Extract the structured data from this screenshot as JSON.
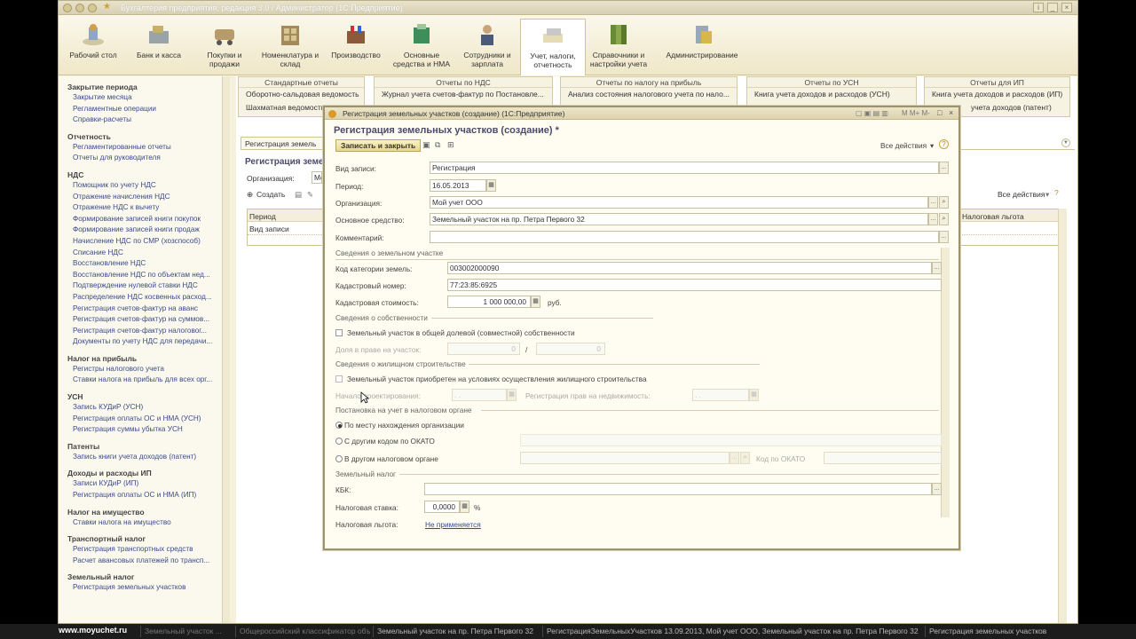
{
  "window": {
    "title": "Бухгалтерия предприятия, редакция 3.0 / Администратор  (1С:Предприятие)"
  },
  "toolbar": {
    "items": [
      {
        "label": "Рабочий стол"
      },
      {
        "label": "Банк и касса"
      },
      {
        "label": "Покупки и продажи"
      },
      {
        "label": "Номенклатура и склад"
      },
      {
        "label": "Производство"
      },
      {
        "label": "Основные средства и НМА"
      },
      {
        "label": "Сотрудники и зарплата"
      },
      {
        "label": "Учет, налоги, отчетность"
      },
      {
        "label": "Справочники и настройки учета"
      },
      {
        "label": "Администрирование"
      }
    ]
  },
  "sidebar": {
    "groups": [
      {
        "title": "Закрытие периода",
        "items": [
          "Закрытие месяца",
          "Регламентные операции",
          "Справки-расчеты"
        ]
      },
      {
        "title": "Отчетность",
        "items": [
          "Регламентированные отчеты",
          "Отчеты для руководителя"
        ]
      },
      {
        "title": "НДС",
        "items": [
          "Помощник по учету НДС",
          "Отражение начисления НДС",
          "Отражение НДС к вычету",
          "Формирование записей книги покупок",
          "Формирование записей книги продаж",
          "Начисление НДС по СМР (хозспособ)",
          "Списание НДС",
          "Восстановление НДС",
          "Восстановление НДС по объектам нед...",
          "Подтверждение нулевой ставки НДС",
          "Распределение НДС косвенных расход...",
          "Регистрация счетов-фактур на аванс",
          "Регистрация счетов-фактур на суммов...",
          "Регистрация счетов-фактур налоговог...",
          "Документы по учету НДС для передачи..."
        ]
      },
      {
        "title": "Налог на прибыль",
        "items": [
          "Регистры налогового учета",
          "Ставки налога на прибыль для всех орг..."
        ]
      },
      {
        "title": "УСН",
        "items": [
          "Запись КУДиР (УСН)",
          "Регистрация оплаты ОС и НМА (УСН)",
          "Регистрация суммы убытка УСН"
        ]
      },
      {
        "title": "Патенты",
        "items": [
          "Запись книги учета доходов (патент)"
        ]
      },
      {
        "title": "Доходы и расходы ИП",
        "items": [
          "Записи КУДиР (ИП)",
          "Регистрация оплаты ОС и НМА (ИП)"
        ]
      },
      {
        "title": "Налог на имущество",
        "items": [
          "Ставки налога на имущество"
        ]
      },
      {
        "title": "Транспортный налог",
        "items": [
          "Регистрация транспортных средств",
          "Расчет авансовых платежей по трансп..."
        ]
      },
      {
        "title": "Земельный налог",
        "items": [
          "Регистрация земельных участков"
        ]
      }
    ]
  },
  "reports": [
    {
      "title": "Стандартные отчеты",
      "lines": [
        "Оборотно-сальдовая ведомость",
        "Шахматная ведомость"
      ]
    },
    {
      "title": "Отчеты по НДС",
      "lines": [
        "Журнал учета счетов-фактур по Постановле..."
      ]
    },
    {
      "title": "Отчеты по налогу на прибыль",
      "lines": [
        "Анализ состояния налогового учета по нало..."
      ]
    },
    {
      "title": "Отчеты по УСН",
      "lines": [
        "Книга учета доходов и расходов (УСН)"
      ]
    },
    {
      "title": "Отчеты для ИП",
      "lines": [
        "Книга учета доходов и расходов (ИП)",
        "учета доходов (патент)"
      ]
    }
  ],
  "list": {
    "tab": "Регистрация земель",
    "header": "Регистрация земе",
    "org_label": "Организация:",
    "org_value": "Мо",
    "create_label": "Создать",
    "all_actions": "Все действия",
    "col_period": "Период",
    "col_kind": "Вид записи",
    "col_benefit": "Налоговая льгота"
  },
  "dialog": {
    "window_title": "Регистрация земельных участков (создание)  (1С:Предприятие)",
    "header": "Регистрация земельных участков (создание) *",
    "save_close": "Записать и закрыть",
    "all_actions": "Все действия",
    "fields": {
      "kind_label": "Вид записи:",
      "kind_value": "Регистрация",
      "period_label": "Период:",
      "period_value": "16.05.2013",
      "org_label": "Организация:",
      "org_value": "Мой учет ООО",
      "asset_label": "Основное средство:",
      "asset_value": "Земельный участок на пр. Петра Первого 32",
      "comment_label": "Комментарий:",
      "comment_value": ""
    },
    "land": {
      "section": "Сведения о земельном участке",
      "category_label": "Код категории земель:",
      "category_value": "003002000090",
      "cadastral_label": "Кадастровый номер:",
      "cadastral_value": "77:23:85:6925",
      "cost_label": "Кадастровая стоимость:",
      "cost_value": "1 000 000,00",
      "cost_unit": "руб."
    },
    "ownership": {
      "section": "Сведения о собственности",
      "shared_label": "Земельный участок в общей долевой (совместной) собственности",
      "share_label": "Доля в праве на участок:",
      "share_num": "0",
      "share_sep": "/",
      "share_den": "0"
    },
    "housing": {
      "section": "Сведения о жилищном строительстве",
      "acquired_label": "Земельный участок приобретен на условиях осуществления жилищного строительства",
      "design_label": "Начало проектирования:",
      "design_value": "  .  .",
      "reg_label": "Регистрация прав на недвижимость:",
      "reg_value": "  .  ."
    },
    "tax_org": {
      "section": "Постановка на учет в налоговом органе",
      "opt1": "По месту нахождения организации",
      "opt2": "С другим кодом по ОКАТО",
      "opt3": "В другом налоговом органе",
      "okato_label": "Код по ОКАТО"
    },
    "land_tax": {
      "section": "Земельный налог",
      "kbk_label": "КБК:",
      "kbk_value": "",
      "rate_label": "Налоговая ставка:",
      "rate_value": "0,0000",
      "rate_unit": "%",
      "benefit_label": "Налоговая льгота:",
      "benefit_value": "Не применяется"
    }
  },
  "taskbar": {
    "watermark": "www.moyuchet.ru",
    "tasks": [
      "Земельный участок ...",
      "Общероссийский классификатор объектов ...",
      "Земельный участок на пр. Петра Первого 32",
      "РегистрацияЗемельныхУчастков 13.09.2013, Мой учет ООО, Земельный участок на пр. Петра Первого 32",
      "Регистрация земельных участков"
    ]
  },
  "colors": {
    "accent": "#f6f1dc",
    "link": "#3a4a8a",
    "primary_button": "#e7d88b"
  }
}
